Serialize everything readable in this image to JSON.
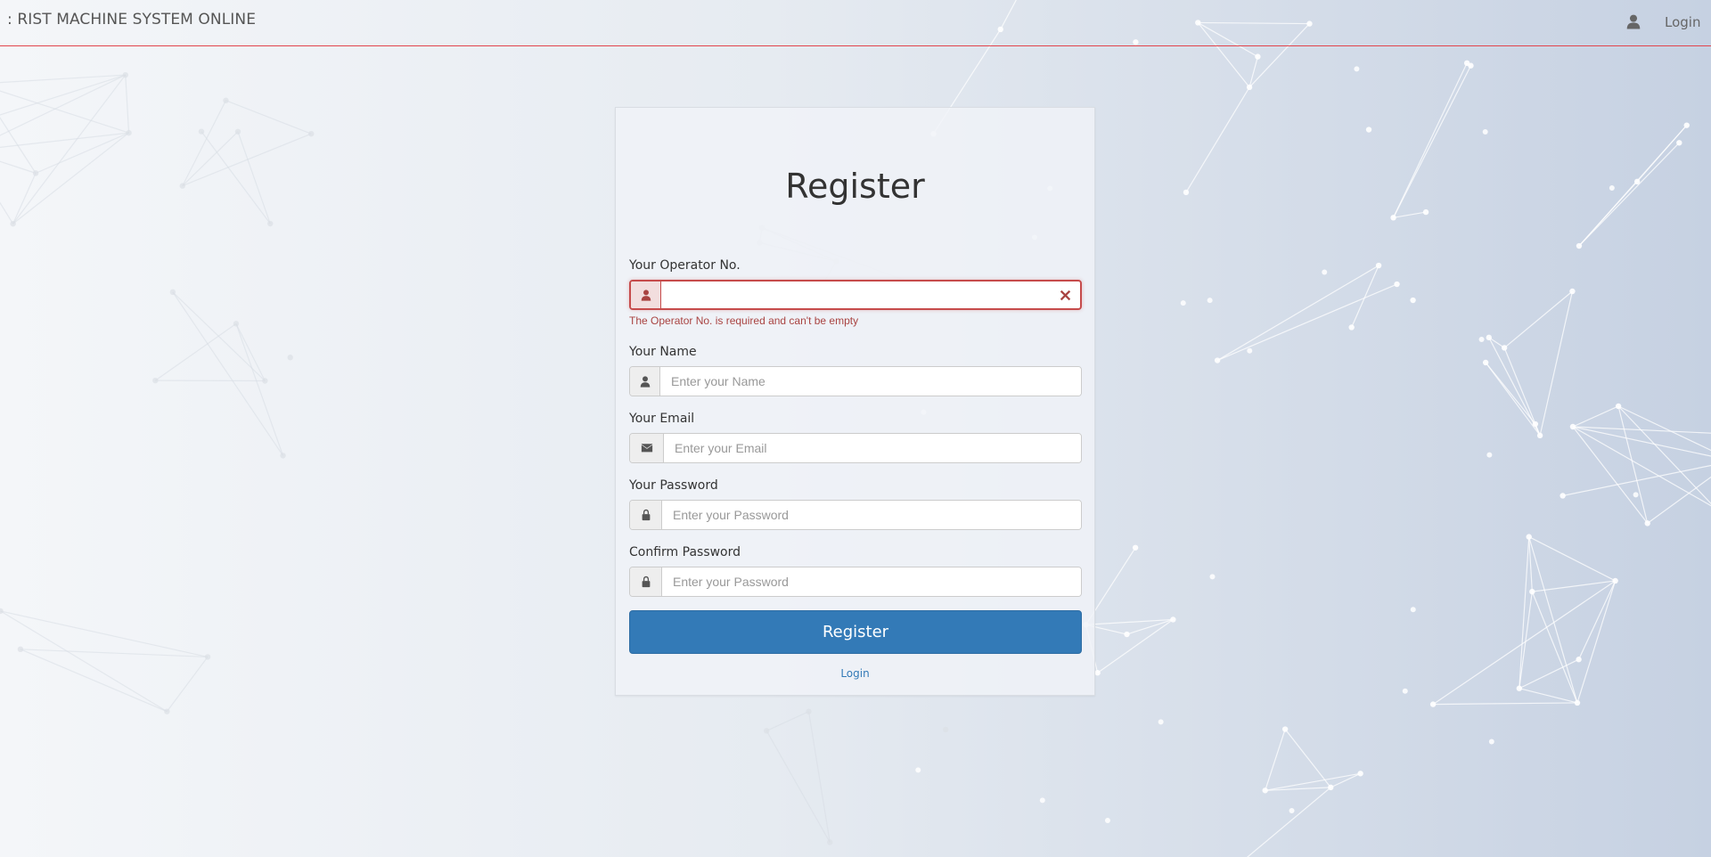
{
  "navbar": {
    "brand": ": RIST MACHINE SYSTEM ONLINE",
    "login_label": "Login",
    "user_icon": "user-icon"
  },
  "form": {
    "title": "Register",
    "fields": {
      "operator": {
        "label": "Your Operator No.",
        "value": "",
        "placeholder": "",
        "icon": "user-icon",
        "error": "The Operator No. is required and can't be empty"
      },
      "name": {
        "label": "Your Name",
        "value": "",
        "placeholder": "Enter your Name",
        "icon": "user-icon"
      },
      "email": {
        "label": "Your Email",
        "value": "",
        "placeholder": "Enter your Email",
        "icon": "envelope-icon"
      },
      "password": {
        "label": "Your Password",
        "value": "",
        "placeholder": "Enter your Password",
        "icon": "lock-icon"
      },
      "confirm": {
        "label": "Confirm Password",
        "value": "",
        "placeholder": "Enter your Password",
        "icon": "lock-icon"
      }
    },
    "submit_label": "Register",
    "login_link": "Login"
  },
  "colors": {
    "accent": "#337ab7",
    "error": "#a94442",
    "navbar_border": "#e2444c"
  }
}
